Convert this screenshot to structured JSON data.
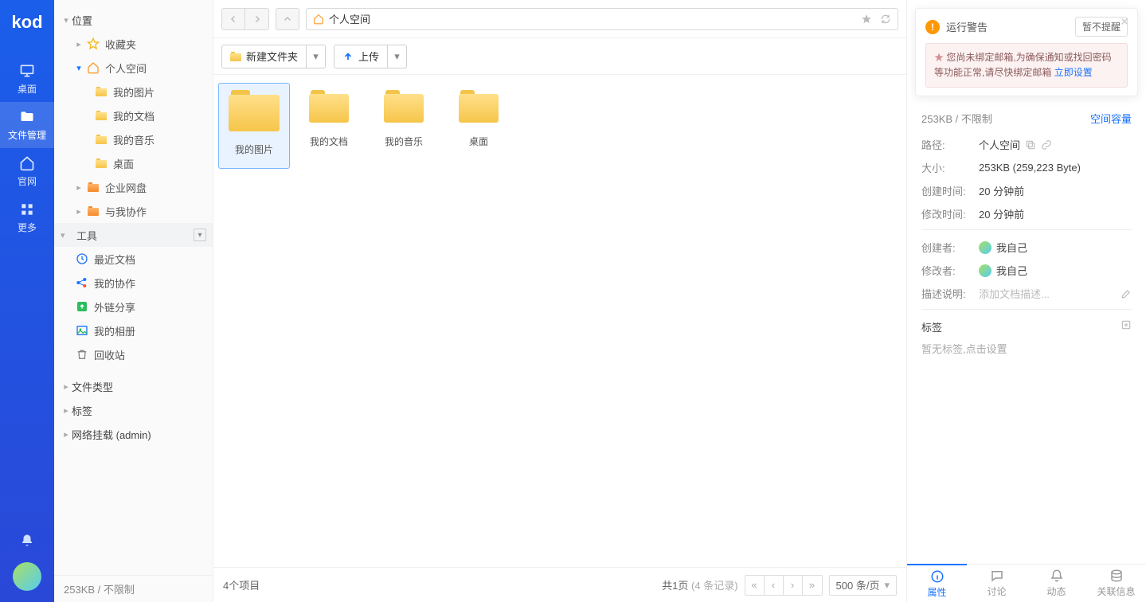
{
  "rail": {
    "logo": "kod",
    "items": [
      {
        "label": "桌面"
      },
      {
        "label": "文件管理"
      },
      {
        "label": "官网"
      },
      {
        "label": "更多"
      }
    ]
  },
  "sidebar": {
    "sections": {
      "location": "位置",
      "favorites": "收藏夹",
      "personal": "个人空间",
      "personal_children": [
        "我的图片",
        "我的文档",
        "我的音乐",
        "桌面"
      ],
      "enterprise": "企业网盘",
      "shared": "与我协作",
      "tools": "工具",
      "tool_items": [
        "最近文档",
        "我的协作",
        "外链分享",
        "我的相册",
        "回收站"
      ],
      "filetype": "文件类型",
      "tags": "标签",
      "netmount": "网络挂载 (admin)"
    },
    "footer": "253KB / 不限制"
  },
  "path": {
    "name": "个人空间"
  },
  "toolbar": {
    "newfolder": "新建文件夹",
    "upload": "上传"
  },
  "files": [
    "我的图片",
    "我的文档",
    "我的音乐",
    "桌面"
  ],
  "status": {
    "count": "4个项目",
    "page_a": "共1页",
    "page_b": "(4 条记录)",
    "per": "500 条/页"
  },
  "warning": {
    "title": "运行警告",
    "snooze": "暂不提醒",
    "body": "您尚未绑定邮箱,为确保通知或找回密码等功能正常,请尽快绑定邮箱",
    "link": "立即设置"
  },
  "props": {
    "sizetop": "253KB / 不限制",
    "quota": "空间容量",
    "rows": {
      "path_k": "路径:",
      "path_v": "个人空间",
      "size_k": "大小:",
      "size_v": "253KB (259,223 Byte)",
      "ctime_k": "创建时间:",
      "ctime_v": "20 分钟前",
      "mtime_k": "修改时间:",
      "mtime_v": "20 分钟前",
      "creator_k": "创建者:",
      "creator_v": "我自己",
      "modifier_k": "修改者:",
      "modifier_v": "我自己",
      "desc_k": "描述说明:",
      "desc_ph": "添加文档描述..."
    },
    "tag_title": "标签",
    "tag_ph": "暂无标签,点击设置"
  },
  "tabs": [
    "属性",
    "讨论",
    "动态",
    "关联信息"
  ]
}
